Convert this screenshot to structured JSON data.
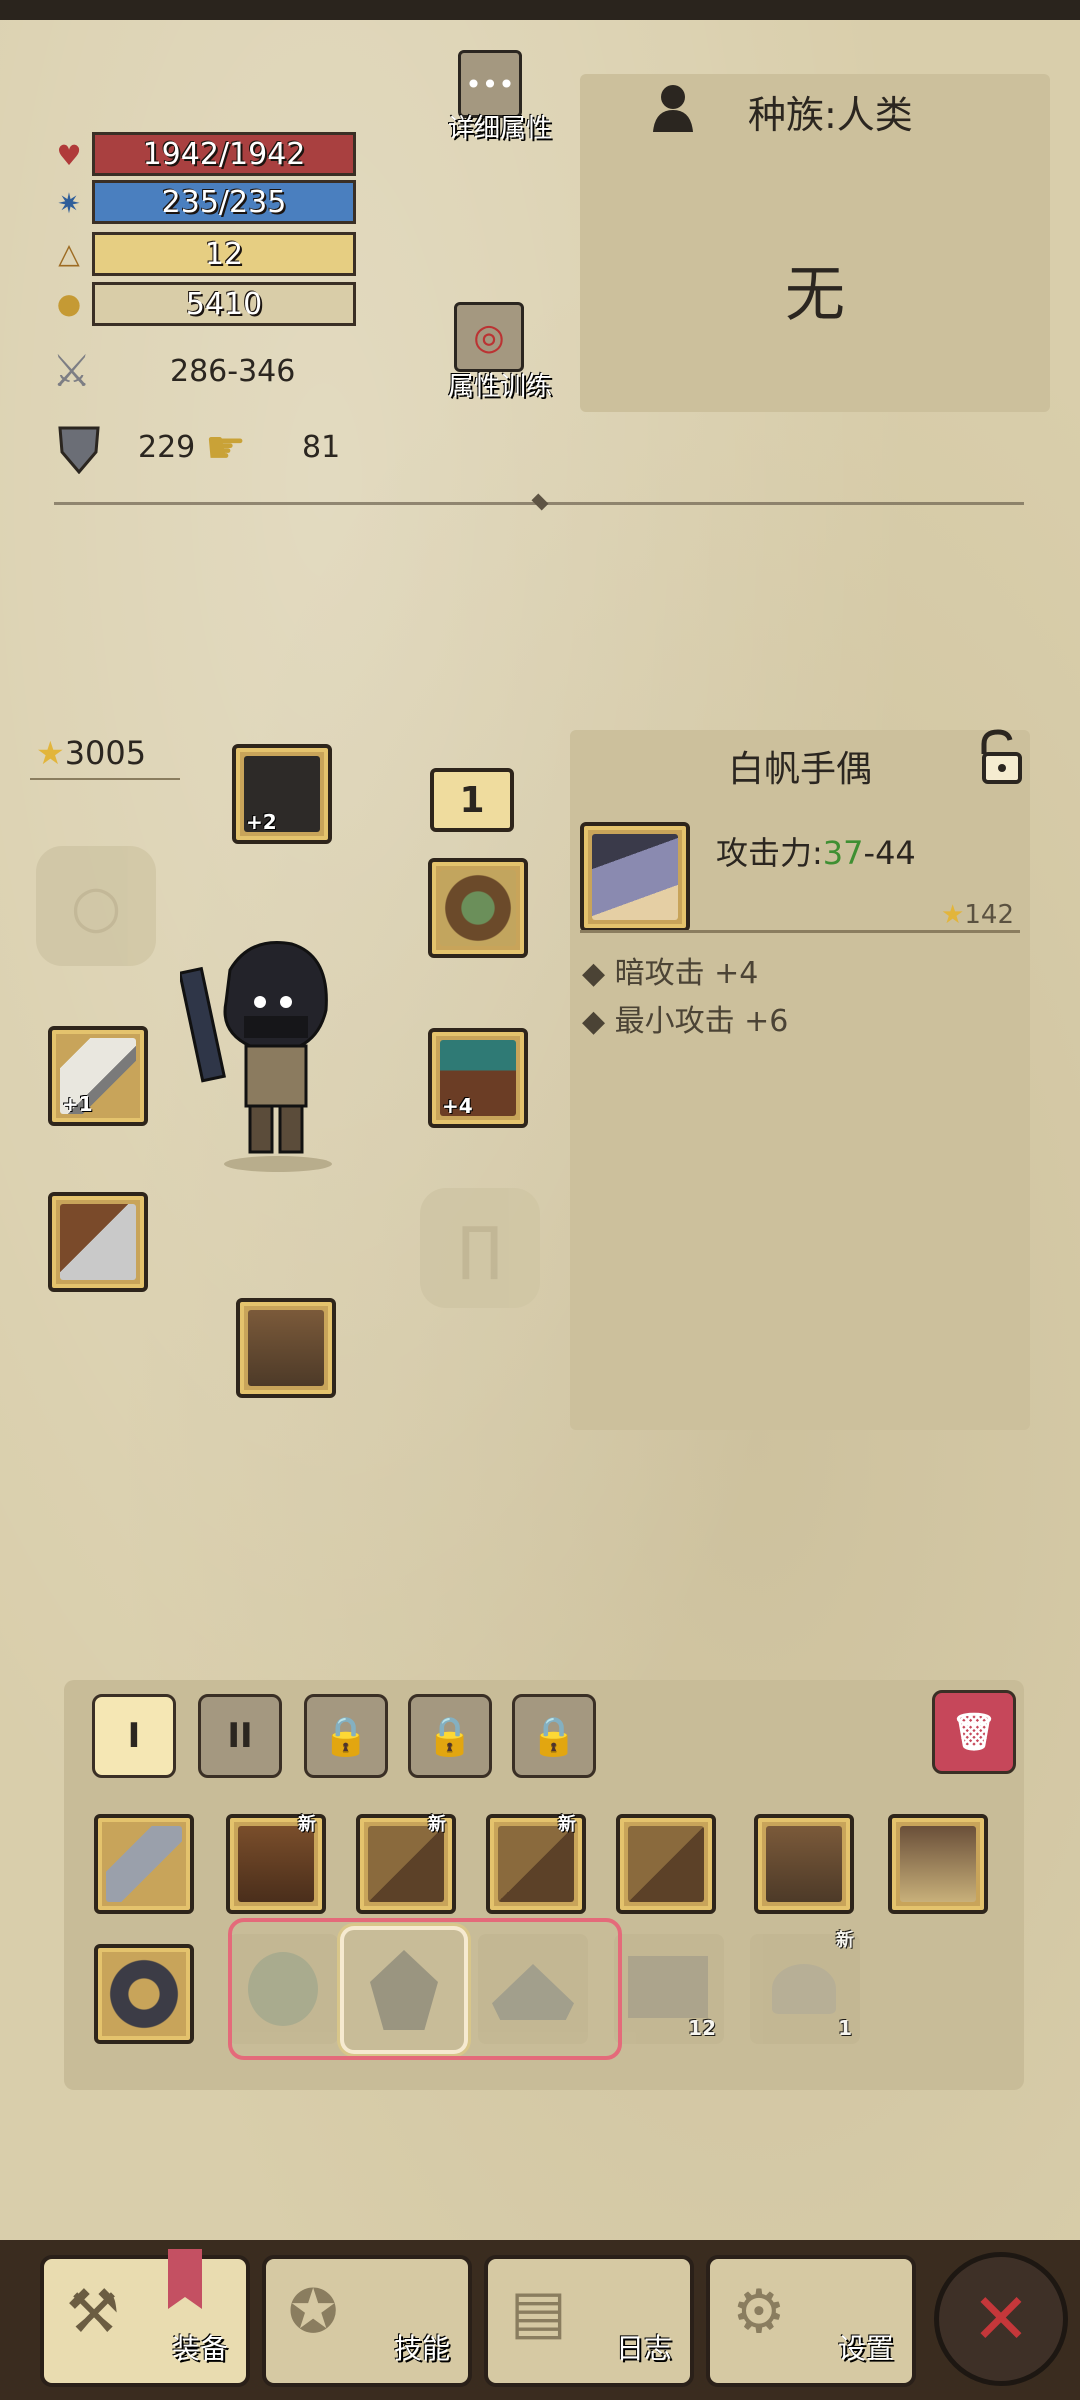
{
  "stats": {
    "hp": "1942/1942",
    "mp": "235/235",
    "level": "12",
    "gold": "5410",
    "attack_range": "286-346",
    "armor": "229",
    "luck": "81"
  },
  "buttons": {
    "detail_attrs": "详细属性",
    "attr_training": "属性训练"
  },
  "race": {
    "label": "种族:人类",
    "value": "无"
  },
  "character": {
    "star_power": "3005",
    "set_tag": "1",
    "slots": {
      "helmet_plus": "+2",
      "weapon_plus": "+1",
      "armor_plus": "+4"
    }
  },
  "item_panel": {
    "name": "白帆手偶",
    "attack_label": "攻击力:",
    "attack_min": "37",
    "attack_sep": "-",
    "attack_max": "44",
    "stars": "142",
    "bonuses": [
      "暗攻击 +4",
      "最小攻击 +6"
    ]
  },
  "bag": {
    "tabs": [
      "I",
      "II"
    ],
    "new_badge": "新",
    "counts": [
      "12",
      "1"
    ]
  },
  "nav": {
    "equip": "装备",
    "skills": "技能",
    "log": "日志",
    "settings": "设置"
  },
  "colors": {
    "hp": "#a94040",
    "mp": "#4a7fbf",
    "attack_min_color": "#3f8f32",
    "highlight": "#e46a7a",
    "close_red": "#c5373a"
  },
  "icons": [
    "heart-icon",
    "mana-icon",
    "level-icon",
    "gold-icon",
    "swords-icon",
    "shield-icon",
    "luck-icon",
    "person-icon",
    "lock-icon",
    "trash-icon",
    "star-icon",
    "close-icon"
  ]
}
